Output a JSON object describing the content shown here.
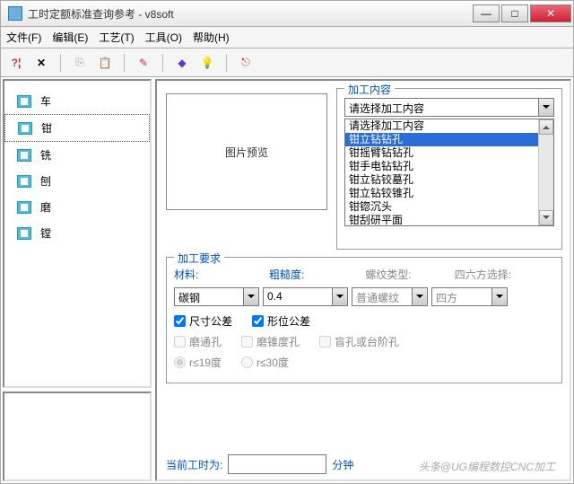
{
  "title": "工时定额标准查询参考 - v8soft",
  "menu": [
    "文件(F)",
    "编辑(E)",
    "工艺(T)",
    "工具(O)",
    "帮助(H)"
  ],
  "nav": [
    "车",
    "钳",
    "铣",
    "刨",
    "磨",
    "镗"
  ],
  "nav_selected": 1,
  "preview_label": "图片预览",
  "group_process": "加工内容",
  "process_combo": "请选择加工内容",
  "process_list": [
    "请选择加工内容",
    "钳立钻钻孔",
    "钳摇臂钻钻孔",
    "钳手电钻钻孔",
    "钳立钻铰墓孔",
    "钳立钻铰锥孔",
    "钳锪沉头",
    "钳刮研平面"
  ],
  "process_sel": 1,
  "group_req": "加工要求",
  "lbl_material": "材料:",
  "lbl_rough": "粗糙度:",
  "lbl_thread": "螺纹类型:",
  "lbl_square": "四六方选择:",
  "val_material": "碳钢",
  "val_rough": "0.4",
  "val_thread": "普通螺纹",
  "val_square": "四方",
  "ck_size": "尺寸公差",
  "ck_shape": "形位公差",
  "ck_through": "磨通孔",
  "ck_cone": "磨锥度孔",
  "ck_blind": "盲孔或台阶孔",
  "rd_19": "r≤19度",
  "rd_30": "r≤30度",
  "lbl_current": "当前工时为:",
  "lbl_min": "分钟",
  "watermark": "头条@UG编程数控CNC加工"
}
